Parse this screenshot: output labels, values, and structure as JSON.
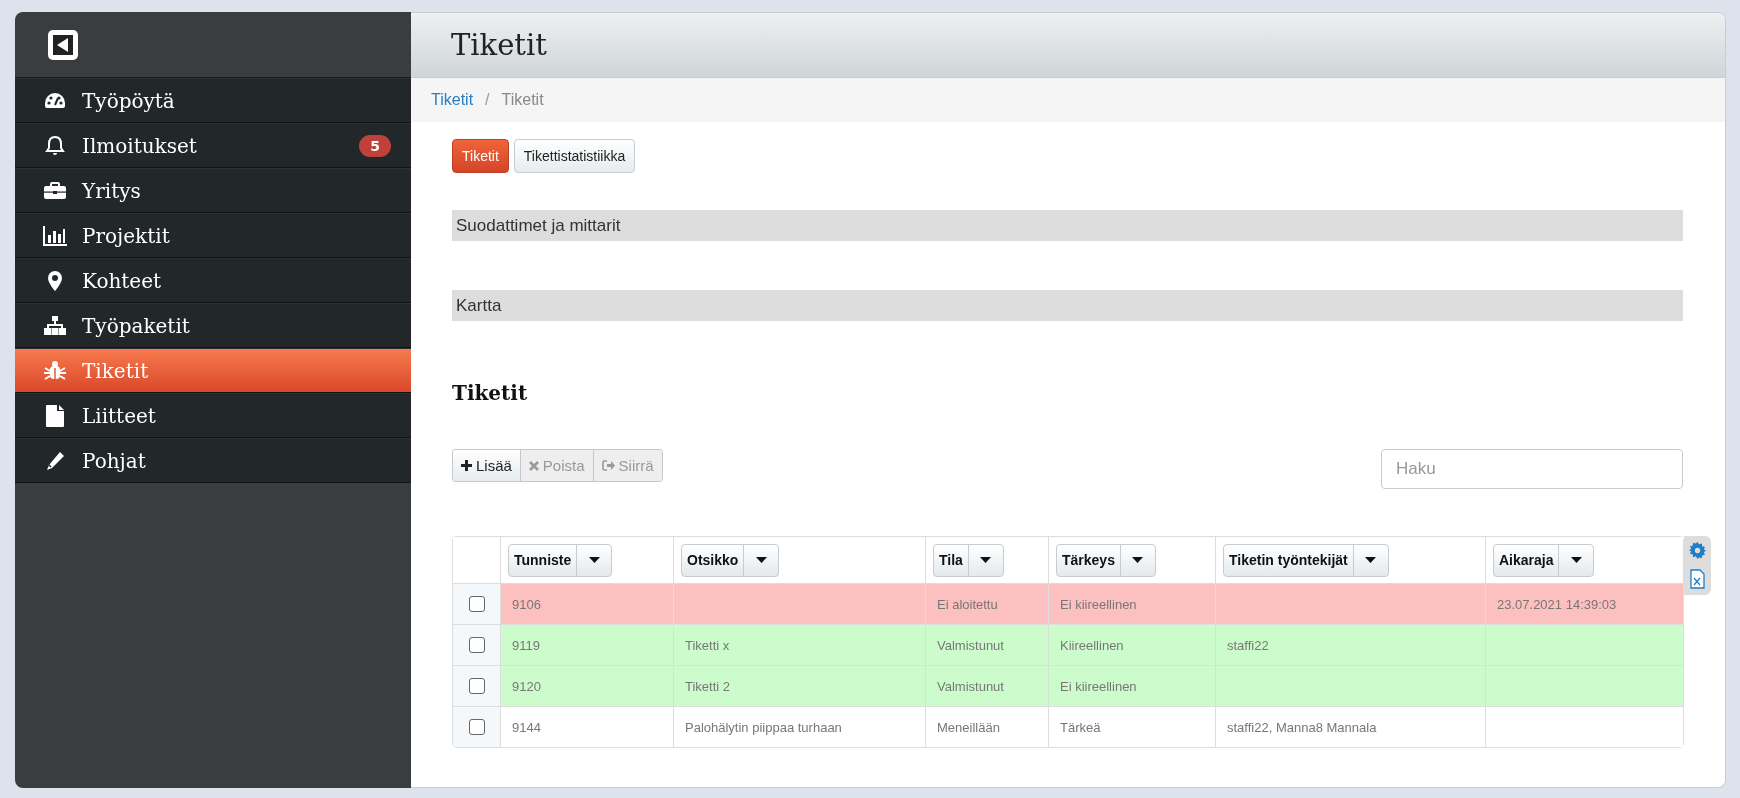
{
  "sidebar": {
    "items": [
      {
        "label": "Työpöytä",
        "selected": false
      },
      {
        "label": "Ilmoitukset",
        "selected": false,
        "badge": "5"
      },
      {
        "label": "Yritys",
        "selected": false
      },
      {
        "label": "Projektit",
        "selected": false
      },
      {
        "label": "Kohteet",
        "selected": false
      },
      {
        "label": "Työpaketit",
        "selected": false
      },
      {
        "label": "Tiketit",
        "selected": true
      },
      {
        "label": "Liitteet",
        "selected": false
      },
      {
        "label": "Pohjat",
        "selected": false
      }
    ]
  },
  "header": {
    "title": "Tiketit"
  },
  "breadcrumb": {
    "items": [
      {
        "label": "Tiketit",
        "link": true
      },
      {
        "label": "Tiketit",
        "link": false
      }
    ],
    "separator": "/"
  },
  "tabs": [
    {
      "label": "Tiketit",
      "selected": true
    },
    {
      "label": "Tikettistatistiikka",
      "selected": false
    }
  ],
  "panels": [
    "Suodattimet ja mittarit",
    "Kartta"
  ],
  "section_title": "Tiketit",
  "toolbar": [
    {
      "label": "Lisää",
      "disabled": false
    },
    {
      "label": "Poista",
      "disabled": true
    },
    {
      "label": "Siirrä",
      "disabled": true
    }
  ],
  "search": {
    "placeholder": "Haku"
  },
  "table": {
    "columns": [
      "Tunniste",
      "Otsikko",
      "Tila",
      "Tärkeys",
      "Tiketin työntekijät",
      "Aikaraja"
    ],
    "rows": [
      {
        "checked": false,
        "color": "#fcc0c0",
        "cells": [
          "9106",
          "",
          "Ei aloitettu",
          "Ei kiireellinen",
          "",
          "23.07.2021 14:39:03"
        ]
      },
      {
        "checked": false,
        "color": "#ccfccc",
        "cells": [
          "9119",
          "Tiketti x",
          "Valmistunut",
          "Kiireellinen",
          "staffi22",
          ""
        ]
      },
      {
        "checked": false,
        "color": "#ccfccc",
        "cells": [
          "9120",
          "Tiketti 2",
          "Valmistunut",
          "Ei kiireellinen",
          "",
          ""
        ]
      },
      {
        "checked": false,
        "color": "#ffffff",
        "cells": [
          "9144",
          "Palohälytin piippaa turhaan",
          "Meneillään",
          "Tärkeä",
          "staffi22, Manna8 Mannala",
          ""
        ]
      }
    ]
  }
}
